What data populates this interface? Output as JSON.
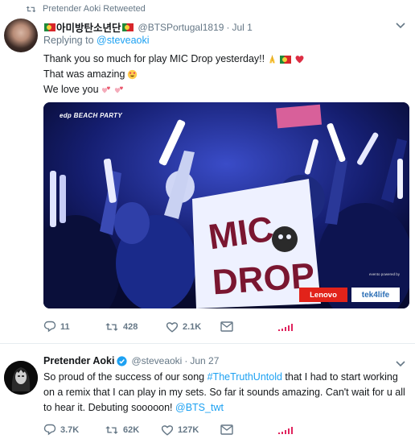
{
  "tweet1": {
    "retweet_context": "Pretender Aoki Retweeted",
    "author_name": "아미방탄소년단",
    "author_handle": "@BTSPortugal1819",
    "separator": "·",
    "time": "Jul 1",
    "replying_to_label": "Replying to",
    "replying_to_handle": "@steveaoki",
    "text_line1": "Thank you so much for play MIC Drop yesterday!!",
    "text_line2": "That was amazing",
    "text_line3": "We love you",
    "media": {
      "overlay_top": "edp BEACH PARTY",
      "sign_text_1": "MIC",
      "sign_text_2": "DROP",
      "sponsor_small": "evento powered by",
      "sponsor_1": "Lenovo",
      "sponsor_2": "tek4life"
    },
    "actions": {
      "replies": "11",
      "retweets": "428",
      "likes": "2.1K"
    }
  },
  "tweet2": {
    "author_name": "Pretender Aoki",
    "author_handle": "@steveaoki",
    "separator": "·",
    "time": "Jun 27",
    "text_part1": "So proud of the success of our song ",
    "hashtag": "#TheTruthUntold",
    "text_part2": " that I had to start working on a remix that I can play in my sets. So far it sounds amazing. Can't wait for u all to hear it. Debuting sooooon! ",
    "mention": "@BTS_twt",
    "actions": {
      "replies": "3.7K",
      "retweets": "62K",
      "likes": "127K"
    }
  },
  "colors": {
    "link_blue": "#1da1f2",
    "muted_gray": "#657786",
    "text_dark": "#14171a",
    "heart_red": "#e0245e",
    "analytics_red": "#e0245e"
  },
  "icons": [
    "retweet-icon",
    "chevron-down-icon",
    "reply-icon",
    "like-icon",
    "message-icon",
    "analytics-icon",
    "verified-icon",
    "portugal-flag-icon",
    "folded-hands-emoji",
    "red-heart-emoji",
    "smiling-heart-eyes-emoji",
    "two-hearts-emoji"
  ]
}
